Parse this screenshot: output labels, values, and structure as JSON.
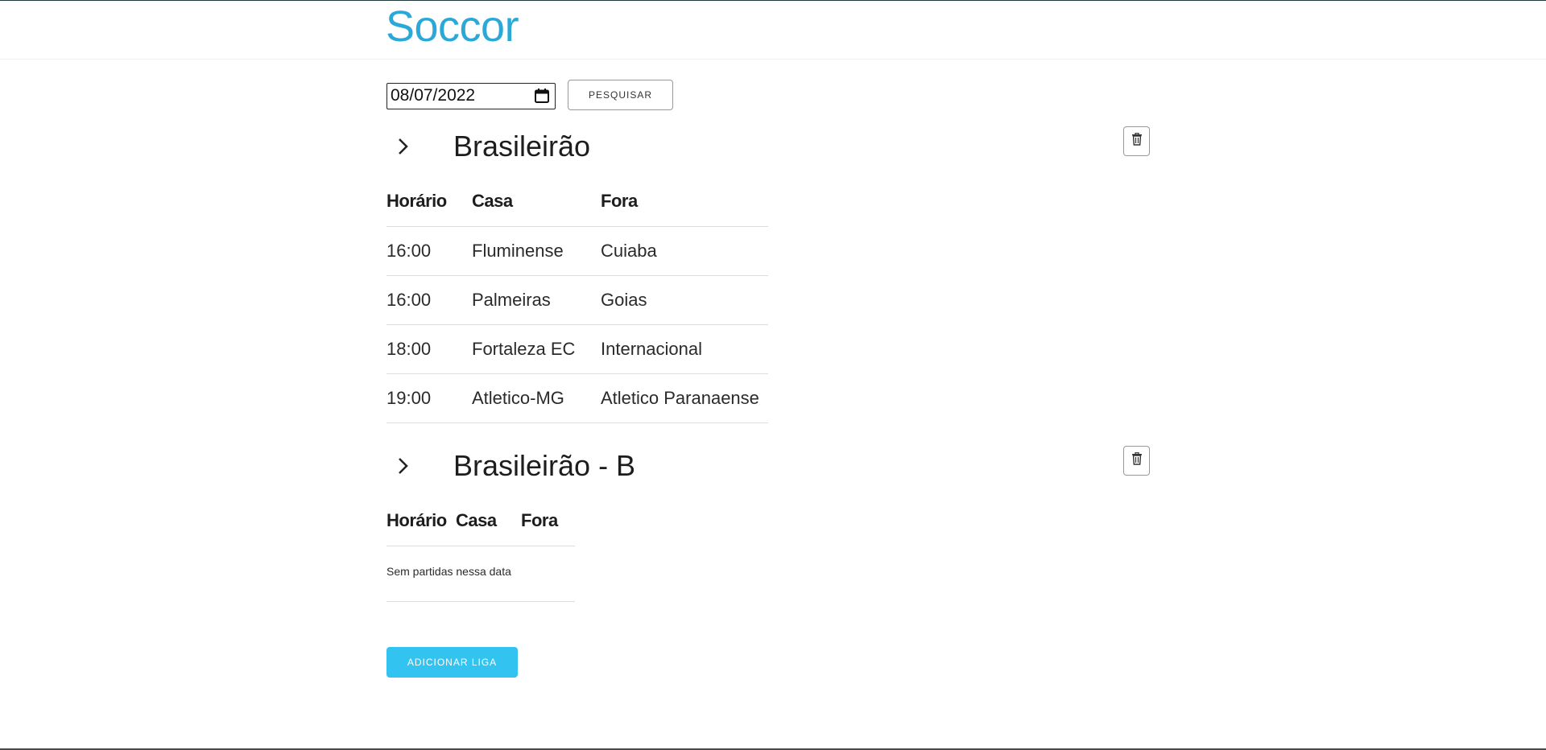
{
  "app": {
    "title": "Soccor"
  },
  "search": {
    "date_value": "08/07/2022",
    "button_label": "PESQUISAR"
  },
  "table_headers": {
    "time": "Horário",
    "home": "Casa",
    "away": "Fora"
  },
  "leagues": [
    {
      "name": "Brasileirão",
      "matches": [
        {
          "time": "16:00",
          "home": "Fluminense",
          "away": "Cuiaba"
        },
        {
          "time": "16:00",
          "home": "Palmeiras",
          "away": "Goias"
        },
        {
          "time": "18:00",
          "home": "Fortaleza EC",
          "away": "Internacional"
        },
        {
          "time": "19:00",
          "home": "Atletico-MG",
          "away": "Atletico Paranaense"
        }
      ]
    },
    {
      "name": "Brasileirão - B",
      "empty_message": "Sem partidas nessa data"
    }
  ],
  "actions": {
    "add_league_label": "ADICIONAR LIGA"
  },
  "icons": {
    "expand": "chevron-right-icon",
    "delete": "trash-icon",
    "calendar": "calendar-icon"
  },
  "colors": {
    "brand": "#2aa9d9",
    "primary_button": "#33c3f0"
  }
}
